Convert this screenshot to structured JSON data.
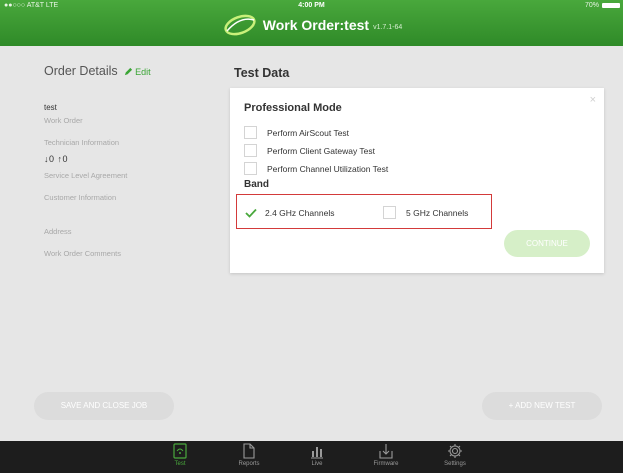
{
  "status_bar": {
    "carrier": "●●○○○ AT&T  LTE",
    "time": "4:00 PM",
    "battery": "70%"
  },
  "header": {
    "title": "Work Order:test",
    "version": "v1.7.1-64"
  },
  "order": {
    "title": "Order Details",
    "edit_label": "Edit",
    "work_order_value": "test",
    "work_order_label": "Work Order",
    "technician_label": "Technician Information",
    "sla_values": "↓0  ↑0",
    "sla_label": "Service Level Agreement",
    "customer_label": "Customer Information",
    "address_label": "Address",
    "comments_label": "Work Order Comments"
  },
  "buttons": {
    "save": "SAVE AND CLOSE JOB",
    "add_test": "+ ADD NEW TEST"
  },
  "test_data": {
    "title": "Test Data",
    "modal": {
      "close": "×",
      "title": "Professional Mode",
      "options": [
        {
          "label": "Perform AirScout Test",
          "checked": false
        },
        {
          "label": "Perform Client Gateway Test",
          "checked": false
        },
        {
          "label": "Perform Channel Utilization Test",
          "checked": false
        }
      ],
      "band_title": "Band",
      "bands": [
        {
          "label": "2.4 GHz Channels",
          "checked": true
        },
        {
          "label": "5 GHz Channels",
          "checked": false
        }
      ],
      "continue_label": "CONTINUE"
    }
  },
  "tabs": [
    {
      "label": "Test",
      "icon": "test-icon",
      "active": true
    },
    {
      "label": "Reports",
      "icon": "reports-icon",
      "active": false
    },
    {
      "label": "Live",
      "icon": "live-icon",
      "active": false
    },
    {
      "label": "Firmware",
      "icon": "firmware-icon",
      "active": false
    },
    {
      "label": "Settings",
      "icon": "settings-icon",
      "active": false
    }
  ],
  "colors": {
    "brand_green": "#3aa535",
    "highlight_red": "#d33a3a",
    "tab_bar": "#1d1d1d"
  }
}
